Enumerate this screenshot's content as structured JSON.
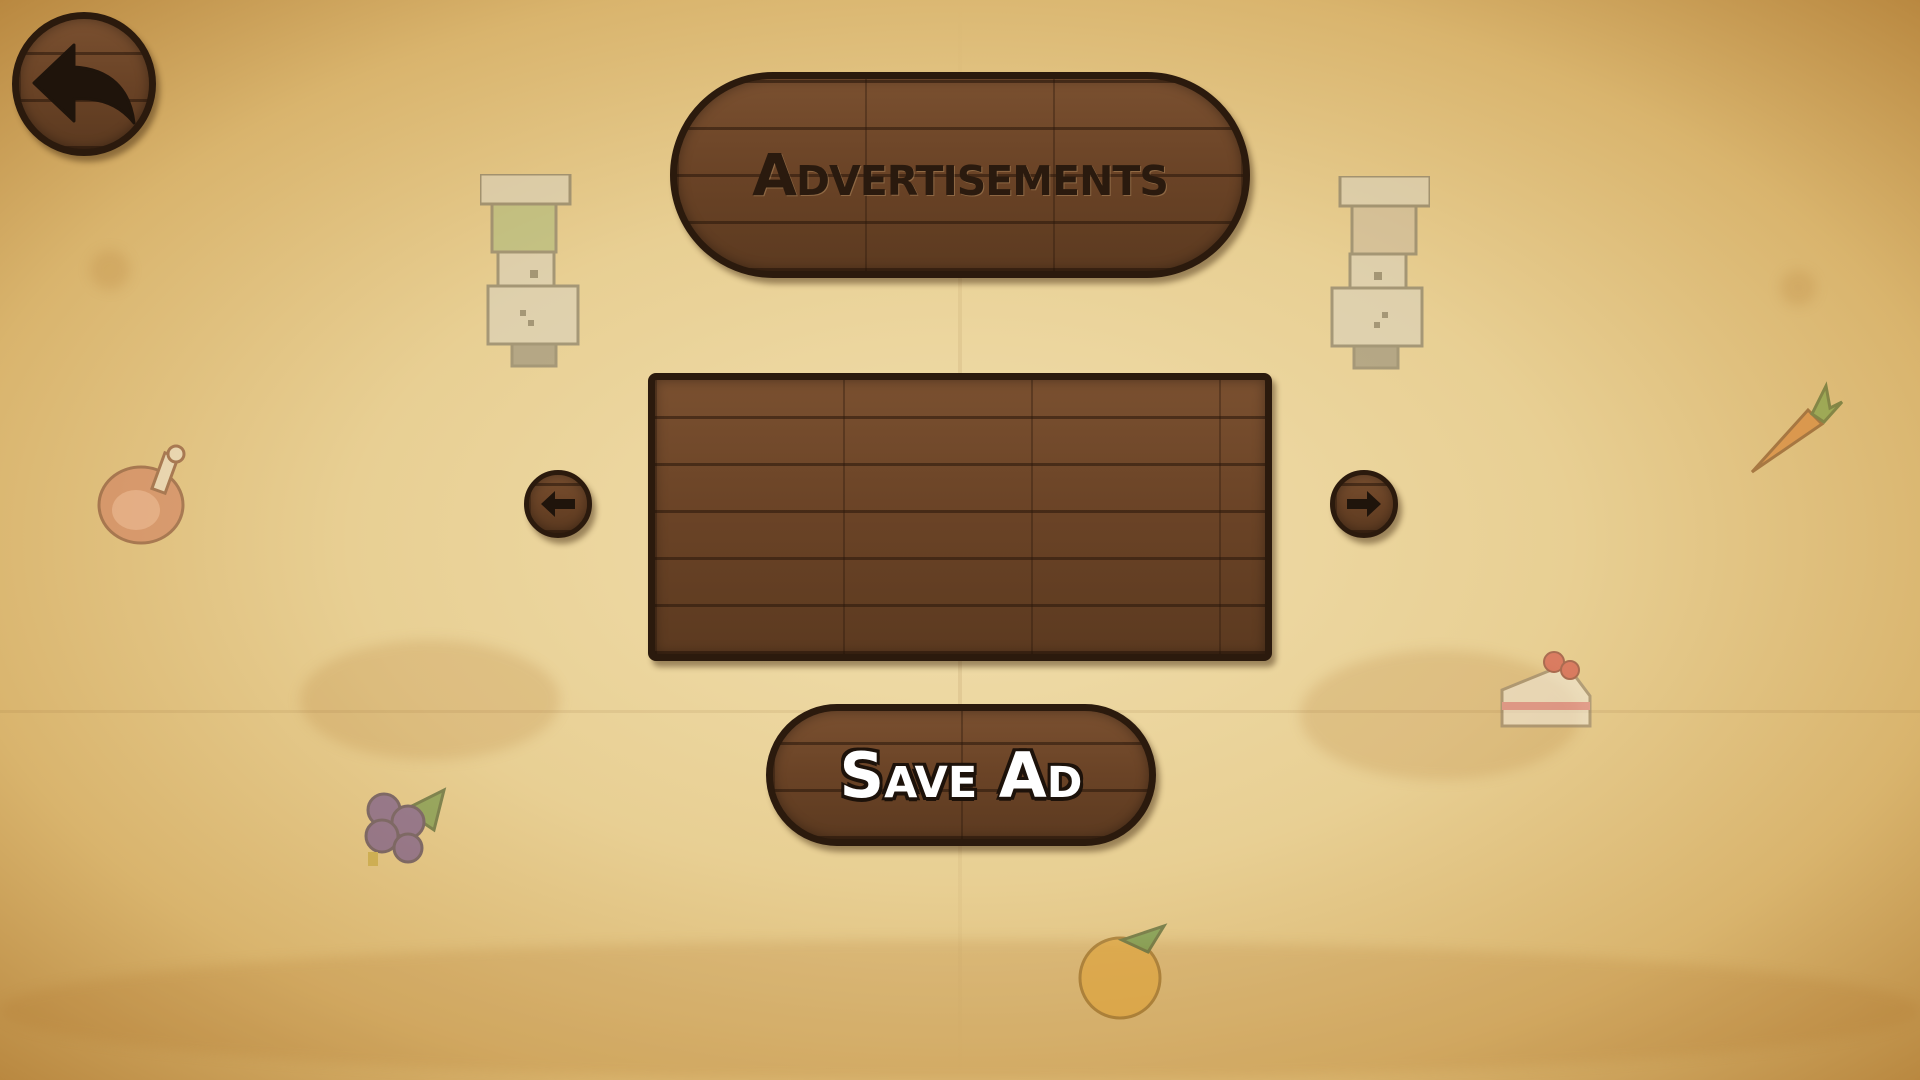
{
  "screen": {
    "title": "Advertisements",
    "save_label": "Save Ad"
  },
  "icons": {
    "back": "back-arrow-icon",
    "prev": "left-arrow-icon",
    "next": "right-arrow-icon",
    "decor": [
      "chef-icon",
      "chef-icon",
      "meat-icon",
      "carrot-icon",
      "cake-icon",
      "grapes-icon",
      "orange-icon"
    ]
  },
  "colors": {
    "parchment": "#e8cf93",
    "wood": "#6b4425",
    "wood_border": "#2b1a0d",
    "title_text": "#2a1a0e",
    "button_text": "#ffffff"
  }
}
